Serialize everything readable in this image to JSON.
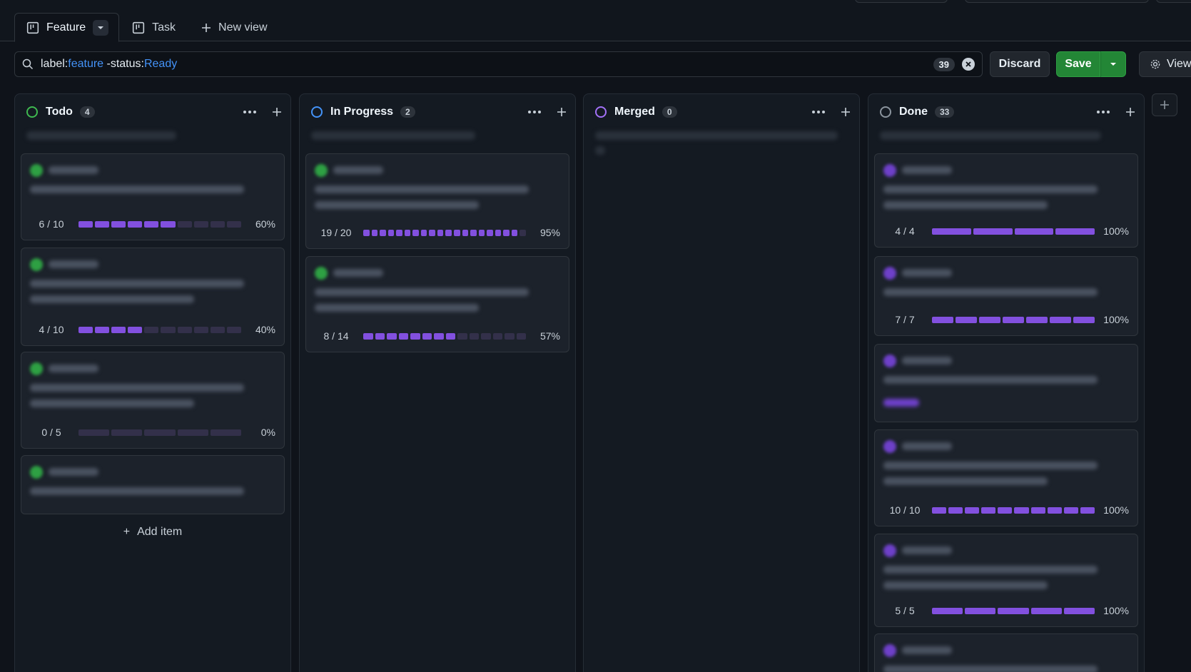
{
  "tabs": [
    {
      "label": "Feature",
      "icon": "board-icon",
      "active": true
    },
    {
      "label": "Task",
      "icon": "board-icon",
      "active": false
    },
    {
      "label": "New view",
      "icon": "plus-icon",
      "active": false
    }
  ],
  "filter": {
    "segments": [
      {
        "text": "label:",
        "accent": false
      },
      {
        "text": "feature",
        "accent": true
      },
      {
        "text": " -status:",
        "accent": false
      },
      {
        "text": "Ready",
        "accent": true
      }
    ],
    "count": "39"
  },
  "actions": {
    "discard": "Discard",
    "save": "Save",
    "view": "View"
  },
  "colors": {
    "accent_blue": "#4493f8",
    "progress": "#8250df",
    "todo": "#3fb950",
    "in_progress": "#4493f8",
    "merged": "#a371f7",
    "done": "#8b949e",
    "save_green": "#238636"
  },
  "columns": [
    {
      "title": "Todo",
      "count": "4",
      "status_color": "#3fb950",
      "cards": [
        {
          "done": 6,
          "total": 10,
          "progress": "6 / 10",
          "pct": "60%"
        },
        {
          "done": 4,
          "total": 10,
          "progress": "4 / 10",
          "pct": "40%"
        },
        {
          "done": 0,
          "total": 5,
          "progress": "0 / 5",
          "pct": "0%"
        },
        {
          "done": null,
          "total": null,
          "progress": "",
          "pct": ""
        }
      ],
      "add_item": "Add item"
    },
    {
      "title": "In Progress",
      "count": "2",
      "status_color": "#4493f8",
      "cards": [
        {
          "done": 19,
          "total": 20,
          "progress": "19 / 20",
          "pct": "95%"
        },
        {
          "done": 8,
          "total": 14,
          "progress": "8 / 14",
          "pct": "57%"
        }
      ]
    },
    {
      "title": "Merged",
      "count": "0",
      "status_color": "#a371f7",
      "cards": []
    },
    {
      "title": "Done",
      "count": "33",
      "status_color": "#8b949e",
      "cards": [
        {
          "done": 4,
          "total": 4,
          "progress": "4 / 4",
          "pct": "100%"
        },
        {
          "done": 7,
          "total": 7,
          "progress": "7 / 7",
          "pct": "100%"
        },
        {
          "done": null,
          "total": null,
          "progress": "",
          "pct": ""
        },
        {
          "done": 10,
          "total": 10,
          "progress": "10 / 10",
          "pct": "100%"
        },
        {
          "done": 5,
          "total": 5,
          "progress": "5 / 5",
          "pct": "100%"
        },
        {
          "done": null,
          "total": null,
          "progress": "",
          "pct": ""
        }
      ]
    }
  ]
}
